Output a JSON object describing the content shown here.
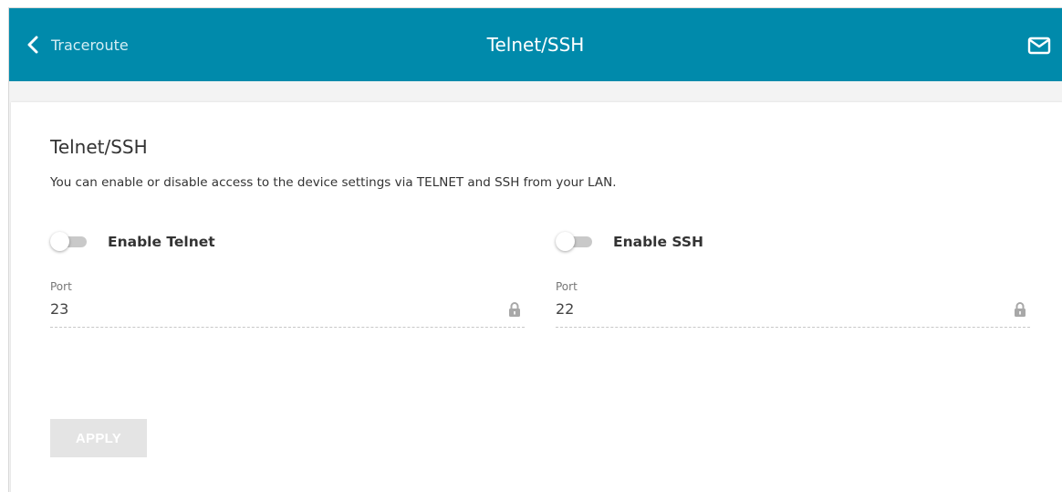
{
  "header": {
    "back_label": "Traceroute",
    "title": "Telnet/SSH",
    "background_color": "#008aab",
    "icons": {
      "back": "chevron-left-icon",
      "mail": "mail-icon"
    }
  },
  "section": {
    "title": "Telnet/SSH",
    "description": "You can enable or disable access to the device settings via TELNET and SSH from your LAN."
  },
  "telnet": {
    "toggle_label": "Enable Telnet",
    "enabled": false,
    "port_label": "Port",
    "port_value": "23",
    "lock_icon": "lock-icon"
  },
  "ssh": {
    "toggle_label": "Enable SSH",
    "enabled": false,
    "port_label": "Port",
    "port_value": "22",
    "lock_icon": "lock-icon"
  },
  "actions": {
    "apply_label": "APPLY",
    "apply_disabled": true
  }
}
